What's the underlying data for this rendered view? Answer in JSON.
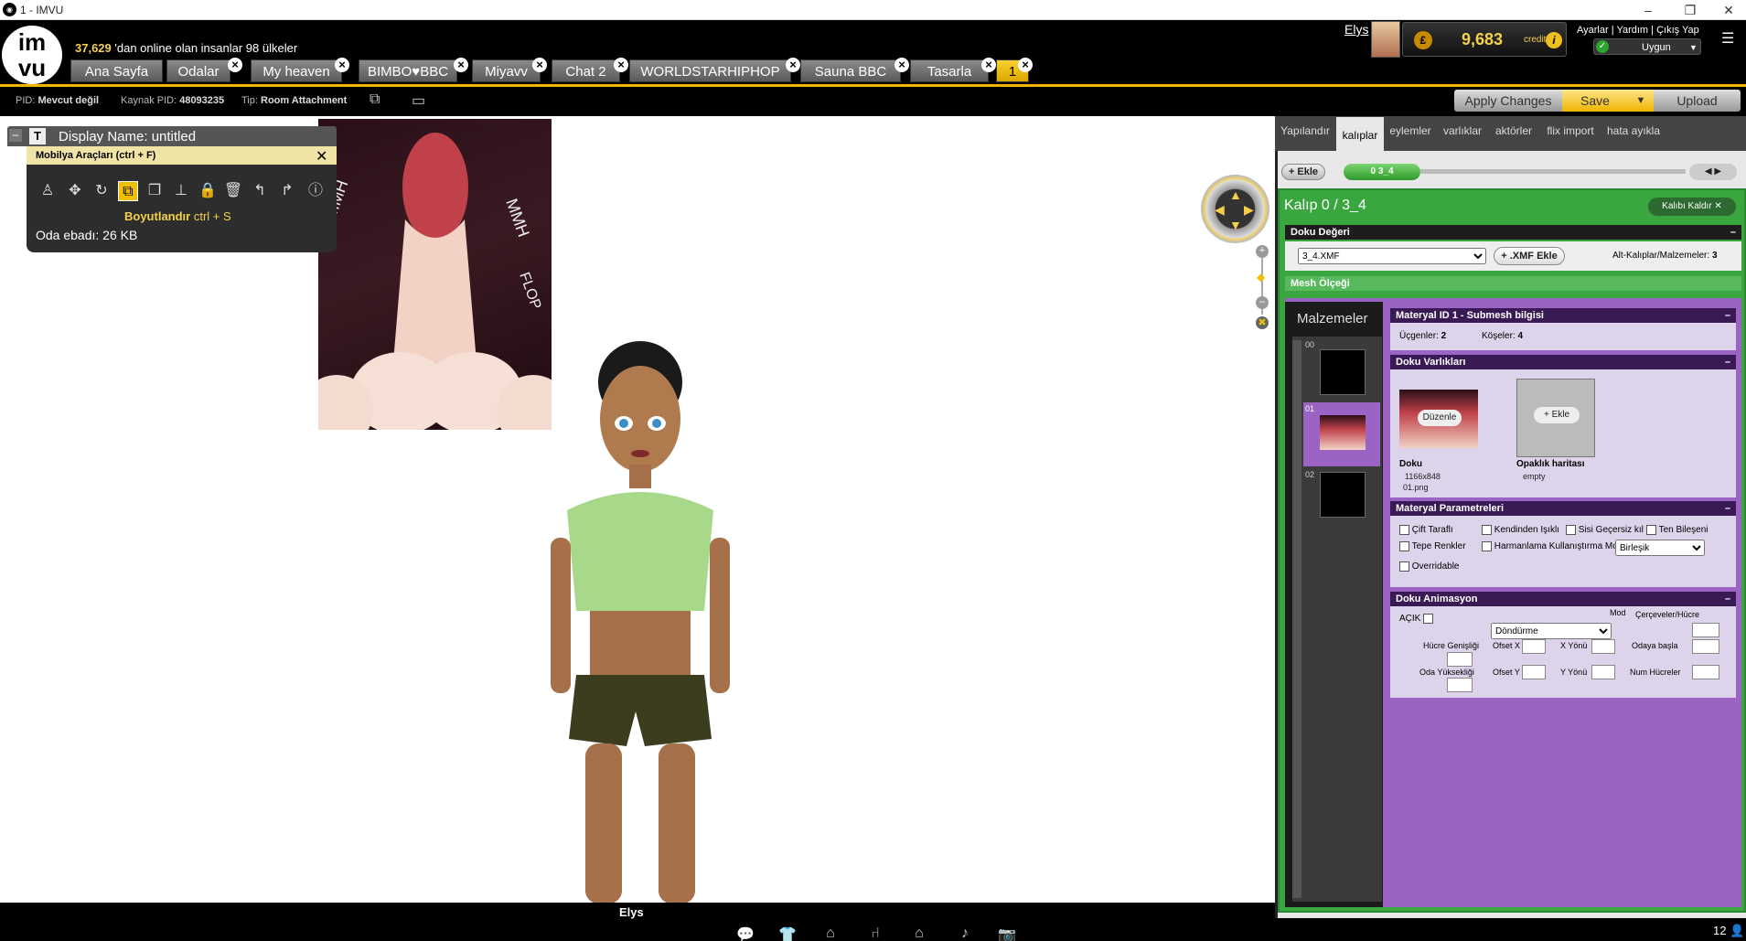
{
  "window": {
    "title": "1 - IMVU"
  },
  "header": {
    "online_count": "37,629",
    "online_text": "'dan online olan insanlar 98 ülkeler",
    "username": "Elys",
    "credits_value": "9,683",
    "credits_label": "credits",
    "links": [
      "Ayarlar",
      "Yardım",
      "Çıkış Yap"
    ],
    "status": "Uygun"
  },
  "tabs": [
    {
      "label": "Ana Sayfa",
      "closable": false
    },
    {
      "label": "Odalar",
      "closable": true
    },
    {
      "label": "My heaven",
      "closable": true
    },
    {
      "label": "BIMBO♥BBC",
      "closable": true
    },
    {
      "label": "Miyavv",
      "closable": true
    },
    {
      "label": "Chat 2",
      "closable": true
    },
    {
      "label": "WORLDSTARHIPHOP",
      "closable": true
    },
    {
      "label": "Sauna BBC",
      "closable": true
    },
    {
      "label": "Tasarla",
      "closable": true
    },
    {
      "label": "1",
      "closable": true,
      "active": true
    }
  ],
  "toolbar": {
    "pid_label": "PID:",
    "pid_value": "Mevcut değil",
    "source_pid_label": "Kaynak PID:",
    "source_pid_value": "48093235",
    "type_label": "Tip:",
    "type_value": "Room Attachment",
    "apply_changes": "Apply Changes",
    "save": "Save",
    "upload": "Upload"
  },
  "display_name": {
    "label": "Display Name: ",
    "value": "untitled"
  },
  "furniture_tools": {
    "title": "Mobilya Araçları (ctrl + F)",
    "active_tool_name": "Boyutlandır",
    "active_tool_shortcut": "ctrl + S",
    "room_size": "Oda ebadı: 26 KB"
  },
  "bottom_bar": {
    "avatar_name": "Elys",
    "count": "12"
  },
  "right_panel": {
    "tabs": [
      "Yapılandır",
      "kalıplar",
      "eylemler",
      "varlıklar",
      "aktörler",
      "flix import",
      "hata ayıkla"
    ],
    "active_tab": "kalıplar",
    "ekle_button": "Ekle",
    "pattern_chip": "0 3_4",
    "kalip_title": "Kalıp 0 / 3_4",
    "kalip_remove": "Kalıbı Kaldır",
    "doku_degeri": {
      "header": "Doku Değeri",
      "selected": "3_4.XMF",
      "add_xmf": ".XMF Ekle",
      "sub_label": "Alt-Kalıplar/Malzemeler:",
      "sub_count": "3"
    },
    "mesh_olcegi": "Mesh Ölçeği",
    "malzemeler": "Malzemeler",
    "material_slots": [
      "00",
      "01",
      "02"
    ],
    "material_info": {
      "header": "Materyal ID 1 - Submesh bilgisi",
      "triangles_label": "Üçgenler:",
      "triangles": "2",
      "vertices_label": "Köşeler:",
      "vertices": "4"
    },
    "doku_varliklari": {
      "header": "Doku Varlıkları",
      "edit_button": "Düzenle",
      "texture_title": "Doku",
      "texture_size": "1166x848",
      "texture_file": "01.png",
      "add_button": "Ekle",
      "opacity_title": "Opaklık haritası",
      "opacity_value": "empty"
    },
    "material_params": {
      "header": "Materyal Parametreleri",
      "double_sided": "Çift Taraflı",
      "self_lit": "Kendinden Işıklı",
      "invisible_shadow": "Sisi Geçersiz kıl",
      "skin_component": "Ten Bileşeni",
      "top_colors": "Tepe Renkler",
      "blend_mode_label": "Harmanlama Kullanıştırma Modu",
      "blend_mode_value": "Birleşik",
      "overridable": "Overridable"
    },
    "doku_animasyon": {
      "header": "Doku Animasyon",
      "on_label": "AÇIK",
      "mode_label": "Mod",
      "mode_value": "Döndürme",
      "frames_label": "Çerçeveler/Hücre",
      "cell_width": "Hücre Genişliği",
      "cell_height": "Oda Yüksekliği",
      "offset_x": "Ofset X",
      "offset_y": "Ofset Y",
      "x_dir": "X Yönü",
      "y_dir": "Y Yönü",
      "start_label": "Odaya başla",
      "num_cells": "Num Hücreler"
    }
  },
  "colors": {
    "accent": "#f5b400",
    "panel_green": "#3aa640",
    "panel_purple": "#9a63c4"
  }
}
